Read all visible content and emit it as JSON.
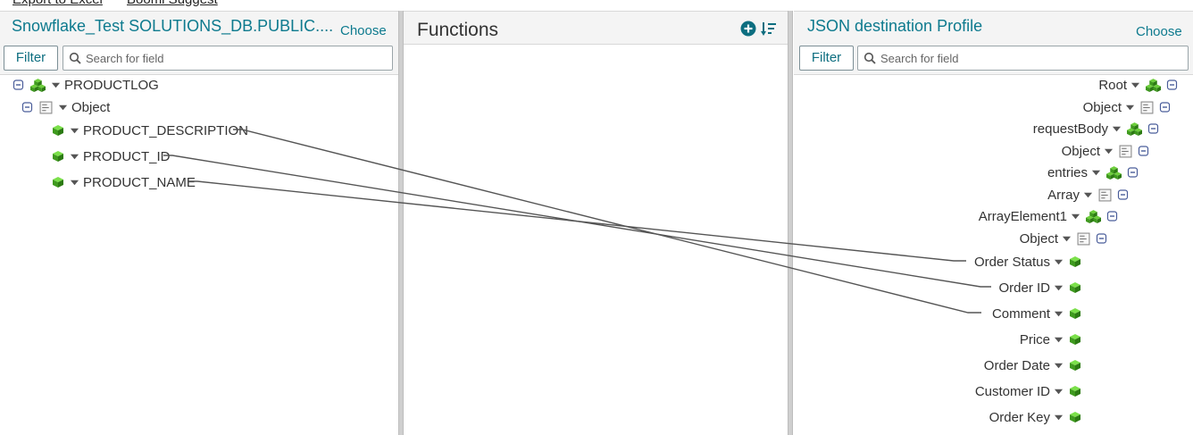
{
  "toolbar": {
    "export_label": "Export to Excel",
    "suggest_label": "Boomi Suggest"
  },
  "source": {
    "title": "Snowflake_Test SOLUTIONS_DB.PUBLIC....",
    "choose_label": "Choose",
    "filter_label": "Filter",
    "search_placeholder": "Search for field",
    "tree": {
      "root": "PRODUCTLOG",
      "object": "Object",
      "fields": [
        "PRODUCT_DESCRIPTION",
        "PRODUCT_ID",
        "PRODUCT_NAME"
      ]
    }
  },
  "functions": {
    "title": "Functions"
  },
  "destination": {
    "title": "JSON destination Profile",
    "choose_label": "Choose",
    "filter_label": "Filter",
    "search_placeholder": "Search for field",
    "tree": {
      "root": "Root",
      "object1": "Object",
      "request_body": "requestBody",
      "object2": "Object",
      "entries": "entries",
      "array": "Array",
      "array_element": "ArrayElement1",
      "object3": "Object",
      "fields": [
        "Order Status",
        "Order ID",
        "Comment",
        "Price",
        "Order Date",
        "Customer ID",
        "Order Key"
      ]
    }
  },
  "mappings": [
    {
      "from": "PRODUCT_DESCRIPTION",
      "to": "Comment"
    },
    {
      "from": "PRODUCT_ID",
      "to": "Order ID"
    },
    {
      "from": "PRODUCT_NAME",
      "to": "Order Status"
    }
  ],
  "icons": {
    "collapse": "minus-square-icon",
    "container": "green-cubes-icon",
    "object": "object-doc-icon",
    "field": "green-cube-icon",
    "dropdown": "caret-down-icon"
  }
}
